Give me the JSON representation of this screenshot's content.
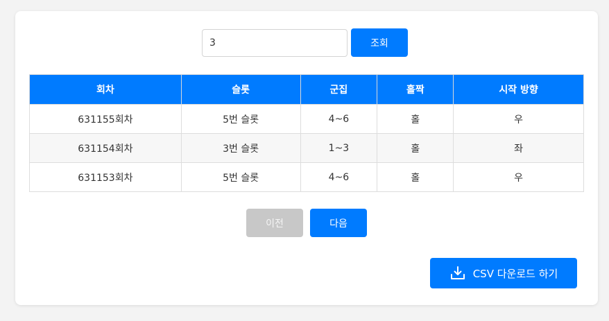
{
  "search": {
    "value": "3",
    "button_label": "조회"
  },
  "table": {
    "headers": [
      "회차",
      "슬롯",
      "군집",
      "홀짝",
      "시작 방향"
    ],
    "rows": [
      [
        "631155회차",
        "5번 슬롯",
        "4~6",
        "홀",
        "우"
      ],
      [
        "631154회차",
        "3번 슬롯",
        "1~3",
        "홀",
        "좌"
      ],
      [
        "631153회차",
        "5번 슬롯",
        "4~6",
        "홀",
        "우"
      ]
    ]
  },
  "pagination": {
    "prev_label": "이전",
    "next_label": "다음",
    "prev_disabled": true
  },
  "download": {
    "label": "CSV 다운로드 하기",
    "icon": "download-icon"
  },
  "colors": {
    "primary": "#007bff",
    "disabled": "#c8c8c8",
    "background": "#f3f3f3"
  }
}
